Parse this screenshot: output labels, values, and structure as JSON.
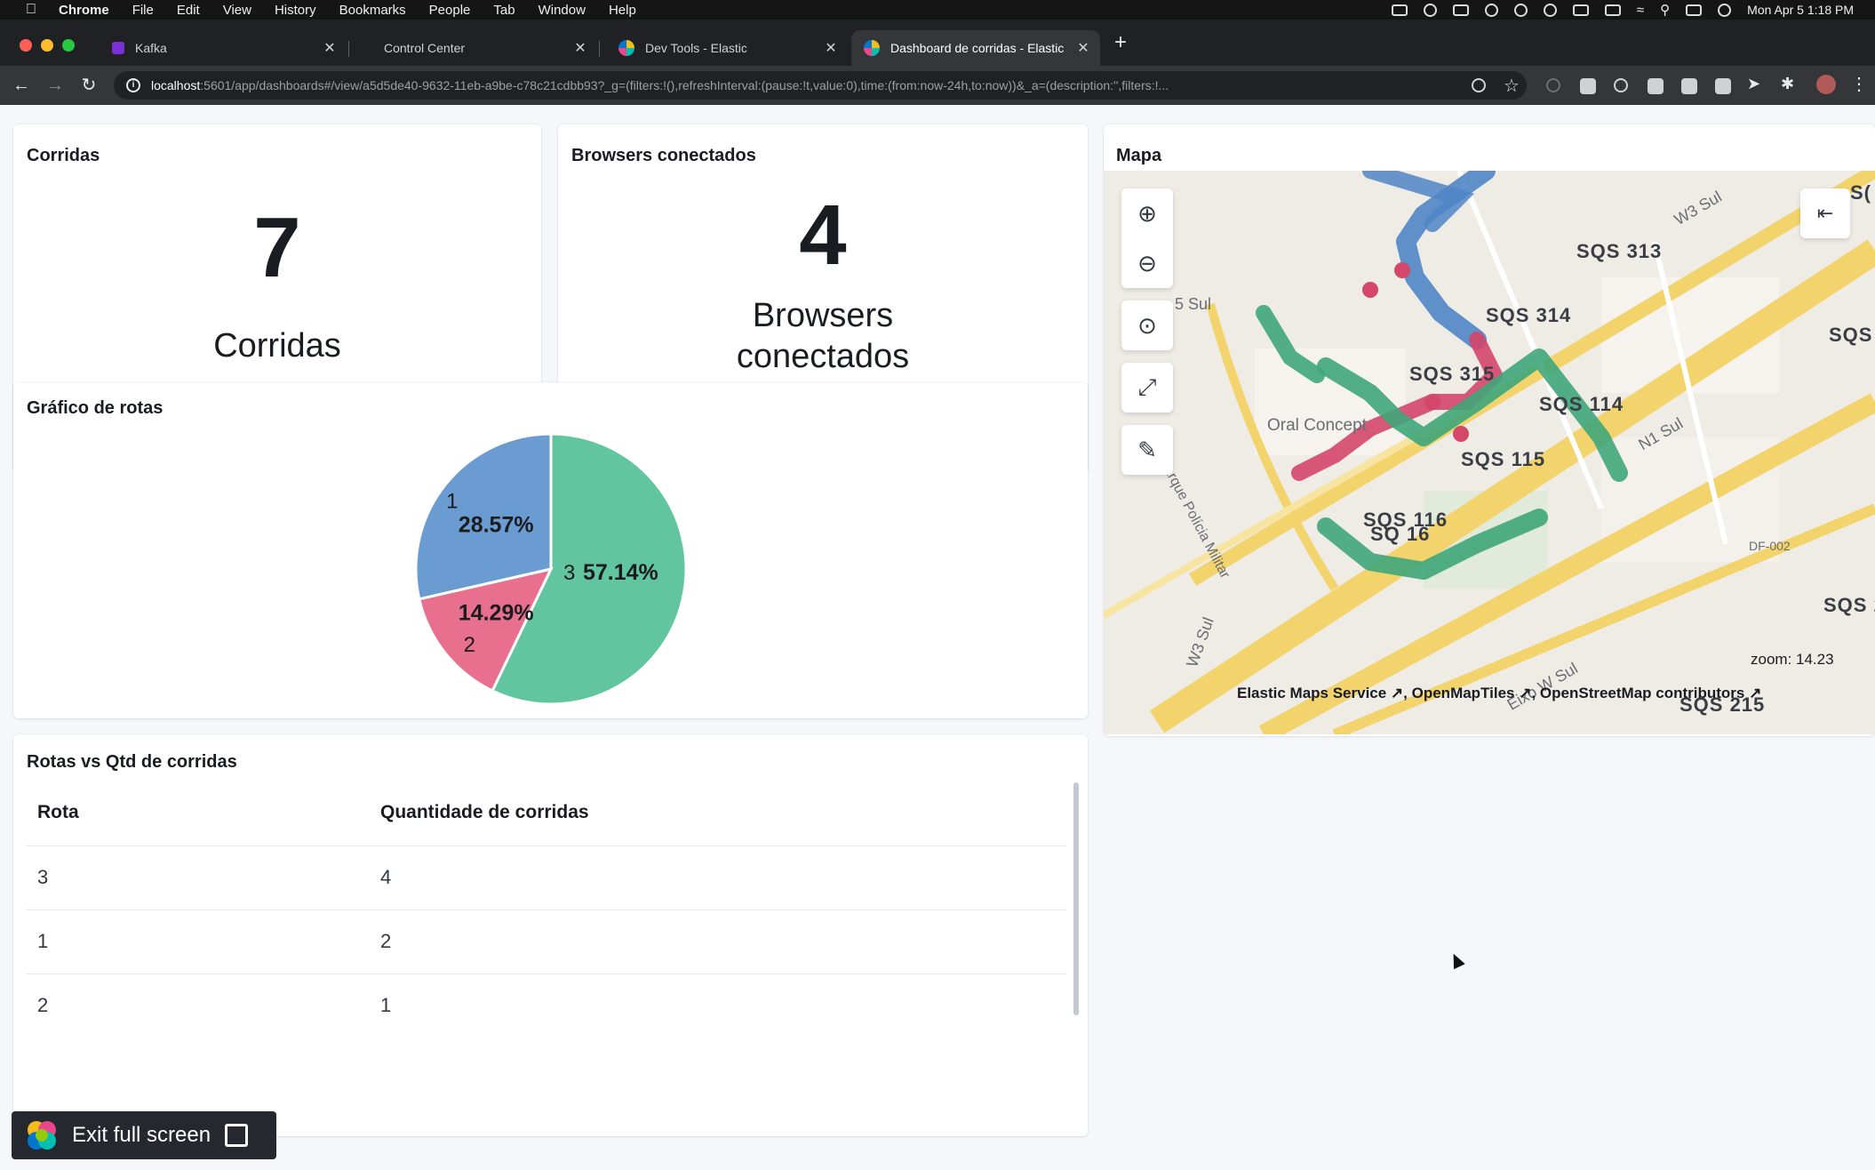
{
  "menubar": {
    "app": "Chrome",
    "items": [
      "File",
      "Edit",
      "View",
      "History",
      "Bookmarks",
      "People",
      "Tab",
      "Window",
      "Help"
    ],
    "clock": "Mon Apr 5  1:18 PM"
  },
  "tabs": [
    {
      "title": "Kafka",
      "favicon_color": "#7b2fd6"
    },
    {
      "title": "Control Center",
      "favicon_color": ""
    },
    {
      "title": "Dev Tools - Elastic",
      "favicon_color": "#f4bd19"
    },
    {
      "title": "Dashboard de corridas - Elastic",
      "favicon_color": "#00bfb3",
      "active": true
    }
  ],
  "address_bar": {
    "host": "localhost",
    "path": ":5601/app/dashboards#/view/a5d5de40-9632-11eb-a9be-c78c21cdbb93?_g=(filters:!(),refreshInterval:(pause:!t,value:0),time:(from:now-24h,to:now))&_a=(description:'',filters:!..."
  },
  "panels": {
    "corridas": {
      "title": "Corridas",
      "value": "7",
      "label": "Corridas"
    },
    "browsers": {
      "title": "Browsers conectados",
      "value": "4",
      "label_line1": "Browsers",
      "label_line2": "conectados"
    },
    "grafico": {
      "title": "Gráfico de rotas"
    },
    "mapa": {
      "title": "Mapa"
    },
    "tabela": {
      "title": "Rotas vs Qtd de corridas",
      "columns": [
        "Rota",
        "Quantidade de corridas"
      ],
      "rows": [
        [
          "3",
          "4"
        ],
        [
          "1",
          "2"
        ],
        [
          "2",
          "1"
        ]
      ]
    }
  },
  "chart_data": {
    "type": "pie",
    "title": "",
    "slices": [
      {
        "label": "3",
        "value": 57.14,
        "value_label": "57.14%",
        "color": "#54b399"
      },
      {
        "label": "2",
        "value": 14.29,
        "value_label": "14.29%",
        "color": "#e7664c"
      },
      {
        "label": "1",
        "value": 28.57,
        "value_label": "28.57%",
        "color": "#6092c0"
      }
    ]
  },
  "map": {
    "labels": [
      "SQS 313",
      "SQS 314",
      "SQS 315",
      "SQS 114",
      "SQS 115",
      "SQS 116",
      "SQS 215",
      "SQS 2",
      "SQS",
      "SQ  16",
      "W3 Sul",
      "N1 Sul",
      "5 Sul",
      "Eixo W Sul",
      "W3 Sul",
      "Oral Concept",
      "Parque Polícia Militar",
      "DF-002",
      "S("
    ],
    "zoom_text": "zoom: 14.23",
    "attribution": "Elastic Maps Service ↗, OpenMapTiles ↗, OpenStreetMap contributors ↗",
    "colors": {
      "green": "#3fa67a",
      "blue": "#4f86c6",
      "red": "#d4466a",
      "road": "#f3d36b"
    }
  },
  "exit_fullscreen": {
    "label": "Exit full screen"
  }
}
